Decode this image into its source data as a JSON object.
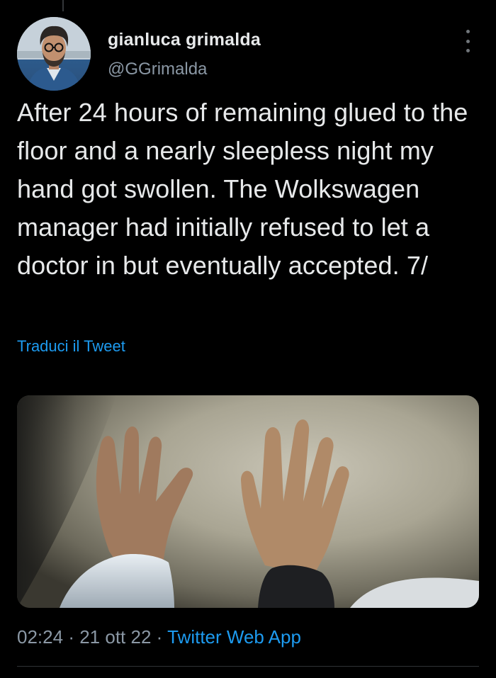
{
  "tweet": {
    "author_name": "gianluca grimalda",
    "author_handle": "@GGrimalda",
    "text": "After 24 hours of remaining glued to the floor and a nearly sleepless night my hand got swollen. The Wolkswagen manager had initially refused to let a doctor in but eventually accepted. 7/",
    "translate_label": "Traduci il Tweet",
    "time": "02:24",
    "separator": "·",
    "date": "21 ott 22",
    "source": "Twitter Web App"
  },
  "media": {
    "icon": "photo-two-hands-icon"
  },
  "colors": {
    "background": "#000000",
    "text": "#e7e9ea",
    "secondary": "#8b98a5",
    "link": "#1d9bf0"
  }
}
